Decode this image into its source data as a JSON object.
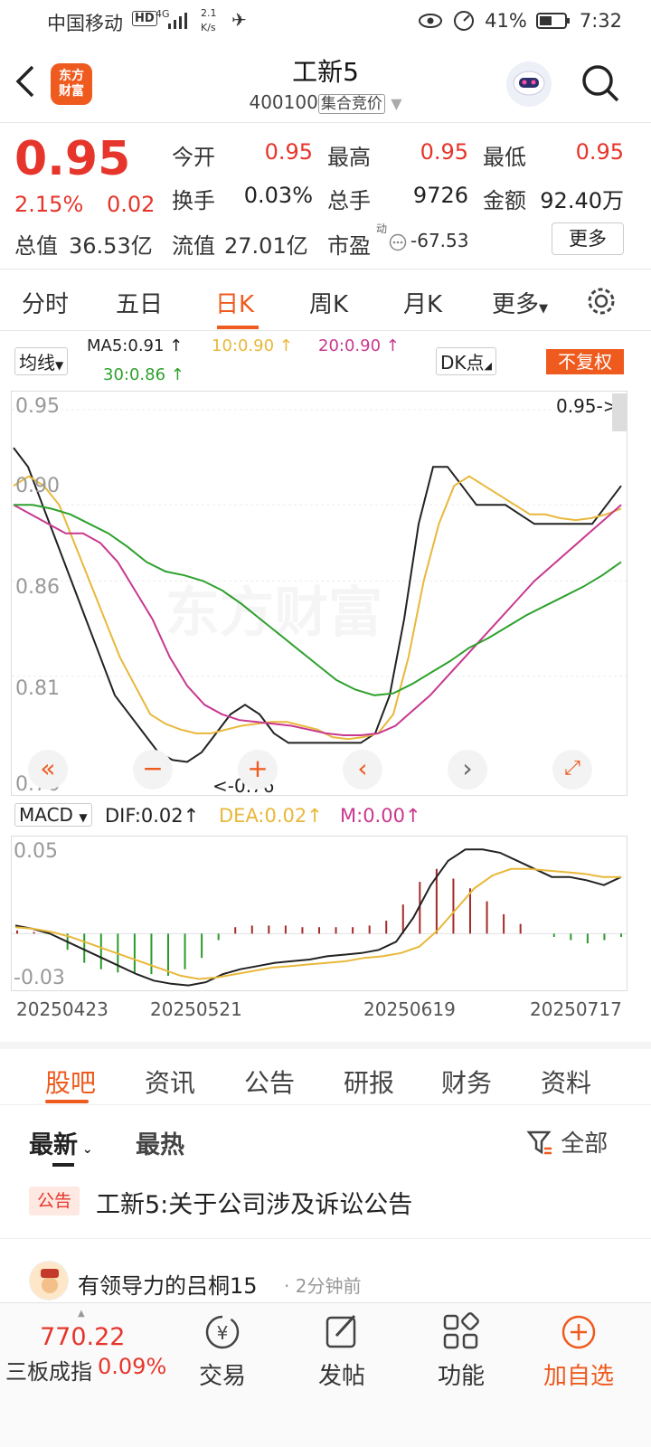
{
  "status_bar": {
    "carrier": "中国移动",
    "net_top": "2.1",
    "net_bottom": "K/s",
    "network_type": "4G",
    "battery": "41%",
    "time": "7:32"
  },
  "header": {
    "logo_text_1": "东方",
    "logo_text_2": "财富",
    "title": "工新5",
    "code": "400100",
    "market_tag": "集合竞价"
  },
  "quote": {
    "price": "0.95",
    "change_pct": "2.15%",
    "change_abs": "0.02",
    "open_label": "今开",
    "open": "0.95",
    "high_label": "最高",
    "high": "0.95",
    "low_label": "最低",
    "low": "0.95",
    "turnover_label": "换手",
    "turnover": "0.03%",
    "volume_label": "总手",
    "volume": "9726",
    "amount_label": "金额",
    "amount": "92.40万",
    "mktcap_label": "总值",
    "mktcap": "36.53亿",
    "float_label": "流值",
    "float_cap": "27.01亿",
    "pe_label": "市盈",
    "pe_sup": "动",
    "pe": "-67.53",
    "more": "更多"
  },
  "period_tabs": [
    "分时",
    "五日",
    "日K",
    "周K",
    "月K",
    "更多"
  ],
  "ma_bar": {
    "selector": "均线",
    "ma5": "MA5:0.91",
    "ma10": "10:0.90",
    "ma20": "20:0.90",
    "ma30": "30:0.86",
    "dk": "DK点",
    "adjust": "不复权"
  },
  "colors": {
    "accent": "#ef5a1e",
    "up": "#e6352b",
    "down": "#2a9a2a",
    "ma5": "#222222",
    "ma10": "#e8b83a",
    "ma20": "#c8388f",
    "ma30": "#2ea12e"
  },
  "kline_axis": {
    "y_labels": [
      "0.95",
      "0.90",
      "0.86",
      "0.81",
      "0.76"
    ],
    "last_marker": "0.95->",
    "min_marker": "<-0.76"
  },
  "chart_data": {
    "type": "line",
    "title": "",
    "xlabel": "",
    "ylabel": "",
    "ylim": [
      0.76,
      0.95
    ],
    "x_ticks": [
      "20250423",
      "20250521",
      "20250619",
      "20250717"
    ],
    "series": [
      {
        "name": "MA5",
        "values": [
          0.93,
          0.92,
          0.9,
          0.88,
          0.86,
          0.84,
          0.82,
          0.8,
          0.79,
          0.78,
          0.77,
          0.766,
          0.765,
          0.77,
          0.78,
          0.79,
          0.795,
          0.79,
          0.78,
          0.775,
          0.775,
          0.775,
          0.775,
          0.775,
          0.775,
          0.78,
          0.8,
          0.84,
          0.89,
          0.92,
          0.92,
          0.91,
          0.9,
          0.9,
          0.9,
          0.895,
          0.89,
          0.89,
          0.89,
          0.89,
          0.89,
          0.9,
          0.91
        ]
      },
      {
        "name": "10",
        "values": [
          0.91,
          0.915,
          0.91,
          0.9,
          0.88,
          0.86,
          0.84,
          0.82,
          0.805,
          0.79,
          0.785,
          0.782,
          0.78,
          0.78,
          0.782,
          0.784,
          0.785,
          0.786,
          0.786,
          0.784,
          0.782,
          0.778,
          0.777,
          0.778,
          0.78,
          0.79,
          0.82,
          0.86,
          0.89,
          0.91,
          0.915,
          0.91,
          0.905,
          0.9,
          0.895,
          0.895,
          0.893,
          0.892,
          0.893,
          0.895,
          0.898
        ]
      },
      {
        "name": "20",
        "values": [
          0.9,
          0.895,
          0.89,
          0.885,
          0.885,
          0.88,
          0.87,
          0.855,
          0.84,
          0.82,
          0.805,
          0.795,
          0.79,
          0.787,
          0.786,
          0.785,
          0.784,
          0.782,
          0.78,
          0.779,
          0.779,
          0.78,
          0.784,
          0.792,
          0.8,
          0.81,
          0.82,
          0.83,
          0.84,
          0.85,
          0.86,
          0.868,
          0.876,
          0.884,
          0.892,
          0.9
        ]
      },
      {
        "name": "30",
        "values": [
          0.9,
          0.9,
          0.898,
          0.895,
          0.89,
          0.885,
          0.878,
          0.87,
          0.865,
          0.863,
          0.86,
          0.855,
          0.848,
          0.84,
          0.832,
          0.824,
          0.816,
          0.808,
          0.803,
          0.8,
          0.801,
          0.806,
          0.812,
          0.818,
          0.825,
          0.83,
          0.836,
          0.842,
          0.847,
          0.852,
          0.857,
          0.863,
          0.87
        ]
      }
    ]
  },
  "macd_bar": {
    "selector": "MACD",
    "dif": "DIF:0.02",
    "dea": "DEA:0.02",
    "m": "M:0.00",
    "y_top": "0.05",
    "y_bottom": "-0.03"
  },
  "macd_data": {
    "dif": [
      0.005,
      0.003,
      0.0,
      -0.005,
      -0.01,
      -0.015,
      -0.02,
      -0.025,
      -0.029,
      -0.031,
      -0.032,
      -0.03,
      -0.025,
      -0.022,
      -0.02,
      -0.018,
      -0.017,
      -0.016,
      -0.014,
      -0.013,
      -0.012,
      -0.01,
      -0.005,
      0.01,
      0.03,
      0.045,
      0.052,
      0.052,
      0.05,
      0.045,
      0.04,
      0.035,
      0.035,
      0.033,
      0.03,
      0.035
    ],
    "dea": [
      0.004,
      0.003,
      0.001,
      -0.002,
      -0.006,
      -0.01,
      -0.014,
      -0.018,
      -0.022,
      -0.026,
      -0.028,
      -0.027,
      -0.025,
      -0.023,
      -0.021,
      -0.02,
      -0.019,
      -0.018,
      -0.017,
      -0.015,
      -0.014,
      -0.012,
      -0.008,
      0.002,
      0.015,
      0.028,
      0.036,
      0.04,
      0.04,
      0.039,
      0.038,
      0.037,
      0.035,
      0.035
    ],
    "hist": [
      0.002,
      0.001,
      0.0,
      -0.01,
      -0.018,
      -0.022,
      -0.024,
      -0.024,
      -0.025,
      -0.026,
      -0.022,
      -0.015,
      -0.004,
      0.004,
      0.005,
      0.005,
      0.005,
      0.004,
      0.004,
      0.004,
      0.004,
      0.005,
      0.008,
      0.018,
      0.032,
      0.04,
      0.034,
      0.028,
      0.02,
      0.012,
      0.006,
      0.0,
      -0.002,
      -0.004,
      -0.006,
      -0.004,
      -0.002
    ]
  },
  "content_tabs": [
    "股吧",
    "资讯",
    "公告",
    "研报",
    "财务",
    "资料"
  ],
  "sort": {
    "latest": "最新",
    "hot": "最热",
    "filter": "全部"
  },
  "posts": [
    {
      "badge": "公告",
      "text": "工新5:关于公司涉及诉讼公告"
    },
    {
      "author": "有领导力的吕桐15",
      "time": "· 2分钟前"
    }
  ],
  "bottom_nav": {
    "index_value": "770.22",
    "index_name": "三板成指",
    "index_pct": "0.09%",
    "items": [
      "交易",
      "发帖",
      "功能",
      "加自选"
    ]
  }
}
